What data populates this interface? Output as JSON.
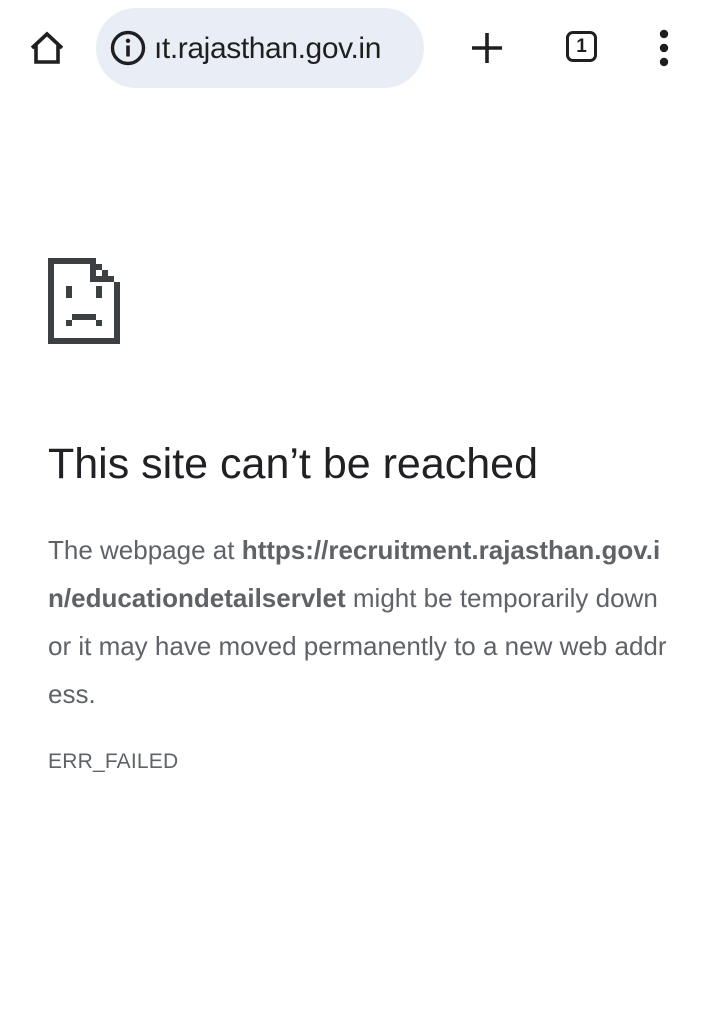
{
  "toolbar": {
    "home_icon": "home-icon",
    "site_info_icon": "info-icon",
    "url": "ıt.rajasthan.gov.in",
    "new_tab_icon": "plus-icon",
    "tab_count": "1",
    "menu_icon": "more-vert-icon"
  },
  "error": {
    "icon": "sad-page-icon",
    "title": "This site can’t be reached",
    "body_prefix": "The webpage at ",
    "url": "https://recruitment.rajasthan.gov.in/educationdetailservlet",
    "body_suffix": " might be temporarily down or it may have moved permanently to a new web address.",
    "code": "ERR_FAILED"
  },
  "colors": {
    "omnibox_bg": "#e9eef6",
    "title_text": "#202124",
    "body_text": "#5f6368",
    "icon": "#1f1f1f"
  }
}
